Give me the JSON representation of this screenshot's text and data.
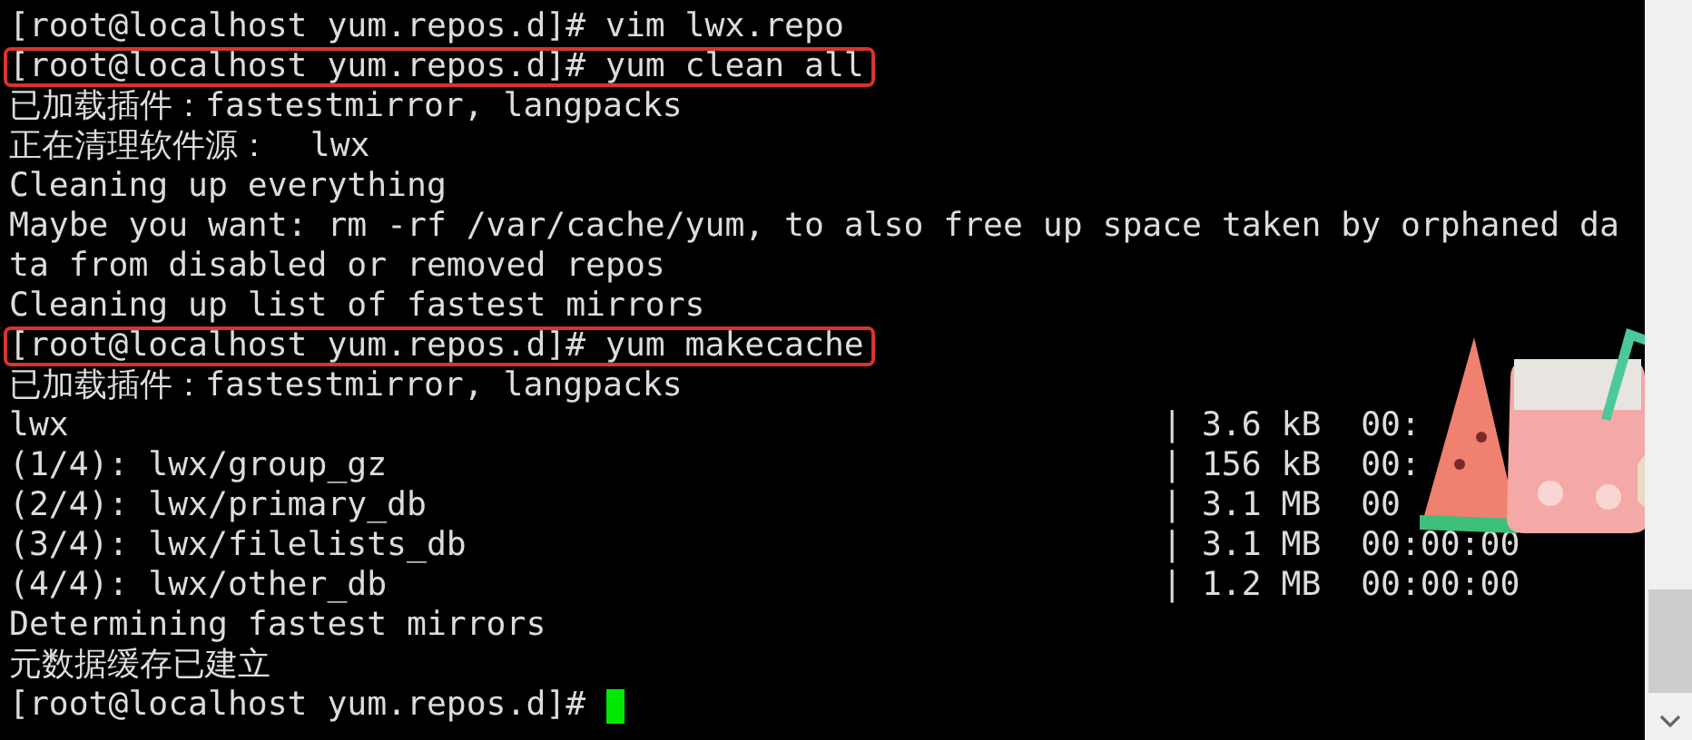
{
  "lines": [
    {
      "kind": "text",
      "text": "[root@localhost yum.repos.d]# vim lwx.repo",
      "highlighted": false
    },
    {
      "kind": "text",
      "text": "[root@localhost yum.repos.d]# yum clean all",
      "highlighted": true
    },
    {
      "kind": "text",
      "text": "已加载插件：fastestmirror, langpacks",
      "highlighted": false
    },
    {
      "kind": "text",
      "text": "正在清理软件源：  lwx",
      "highlighted": false
    },
    {
      "kind": "text",
      "text": "Cleaning up everything",
      "highlighted": false
    },
    {
      "kind": "text",
      "text": "Maybe you want: rm -rf /var/cache/yum, to also free up space taken by orphaned da",
      "highlighted": false
    },
    {
      "kind": "text",
      "text": "ta from disabled or removed repos",
      "highlighted": false
    },
    {
      "kind": "text",
      "text": "Cleaning up list of fastest mirrors",
      "highlighted": false
    },
    {
      "kind": "text",
      "text": "[root@localhost yum.repos.d]# yum makecache",
      "highlighted": true
    },
    {
      "kind": "text",
      "text": "已加载插件：fastestmirror, langpacks",
      "highlighted": false
    },
    {
      "kind": "download",
      "text": "lwx",
      "bar": "|",
      "size": "3.6 kB",
      "time": "00:"
    },
    {
      "kind": "download",
      "text": "(1/4): lwx/group_gz",
      "bar": "|",
      "size": "156 kB",
      "time": "00:"
    },
    {
      "kind": "download",
      "text": "(2/4): lwx/primary_db",
      "bar": "|",
      "size": "3.1 MB",
      "time": "00"
    },
    {
      "kind": "download",
      "text": "(3/4): lwx/filelists_db",
      "bar": "|",
      "size": "3.1 MB",
      "time": "00:00:00"
    },
    {
      "kind": "download",
      "text": "(4/4): lwx/other_db",
      "bar": "|",
      "size": "1.2 MB",
      "time": "00:00:00"
    },
    {
      "kind": "text",
      "text": "Determining fastest mirrors",
      "highlighted": false
    },
    {
      "kind": "text",
      "text": "元数据缓存已建立",
      "highlighted": false
    },
    {
      "kind": "prompt",
      "text": "[root@localhost yum.repos.d]#",
      "cursor": true
    }
  ]
}
